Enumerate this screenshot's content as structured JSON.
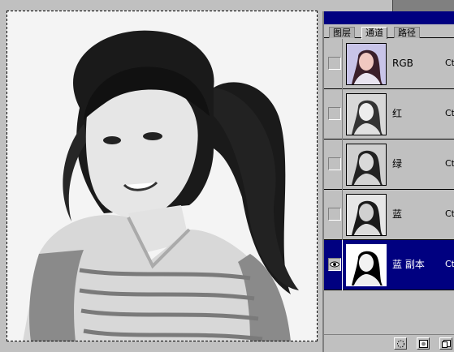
{
  "palette": {
    "tabs": [
      {
        "label": "图层",
        "active": false
      },
      {
        "label": "通道",
        "active": true
      },
      {
        "label": "路径",
        "active": false
      }
    ],
    "channels": [
      {
        "name": "RGB",
        "shortcut": "Ct",
        "visible": false,
        "selected": false,
        "thumb": "color"
      },
      {
        "name": "红",
        "shortcut": "Ct",
        "visible": false,
        "selected": false,
        "thumb": "gray"
      },
      {
        "name": "绿",
        "shortcut": "Ct",
        "visible": false,
        "selected": false,
        "thumb": "gray"
      },
      {
        "name": "蓝",
        "shortcut": "Ct",
        "visible": false,
        "selected": false,
        "thumb": "gray"
      },
      {
        "name": "蓝 副本",
        "shortcut": "Ct",
        "visible": true,
        "selected": true,
        "thumb": "contrast"
      }
    ],
    "buttons": [
      "load-selection-icon",
      "save-selection-icon",
      "new-channel-icon"
    ]
  },
  "colors": {
    "titlebar": "#000080",
    "selected_row": "#000080",
    "panel": "#c0c0c0"
  }
}
